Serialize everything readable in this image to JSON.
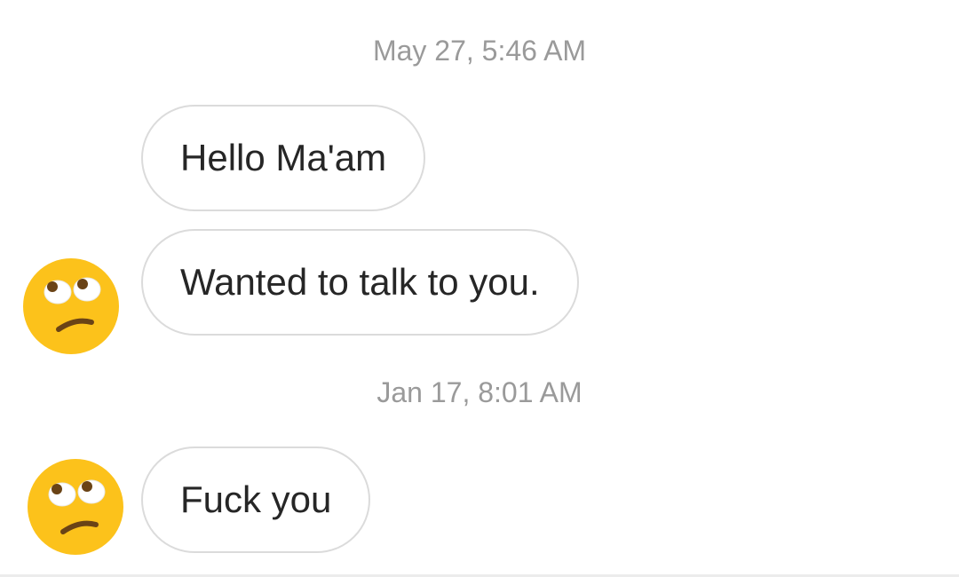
{
  "conversation": {
    "groups": [
      {
        "timestamp": "May 27, 5:46 AM",
        "messages": [
          "Hello Ma'am",
          "Wanted to talk to you."
        ],
        "avatar_icon": "face-with-rolling-eyes-icon"
      },
      {
        "timestamp": "Jan 17, 8:01 AM",
        "messages": [
          "Fuck you"
        ],
        "avatar_icon": "face-with-rolling-eyes-icon"
      }
    ]
  },
  "colors": {
    "background": "#ffffff",
    "bubble_border": "#dbdbdb",
    "message_text": "#262626",
    "timestamp_text": "#9a9a9a",
    "emoji_face": "#fcc21b"
  }
}
